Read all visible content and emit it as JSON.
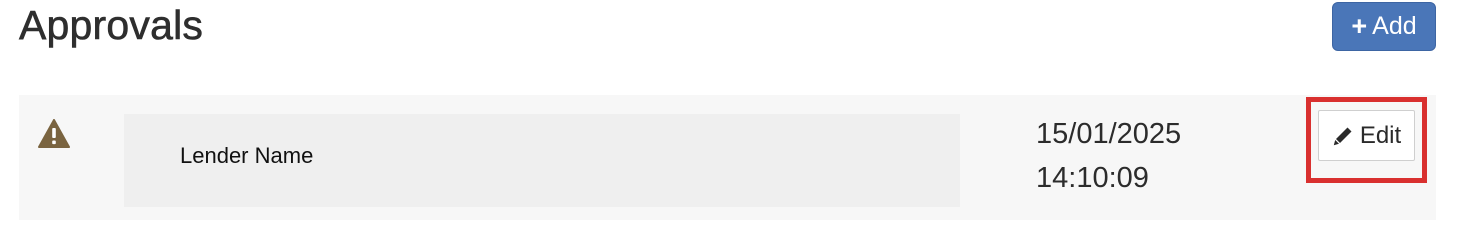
{
  "header": {
    "title": "Approvals",
    "add_label": "Add"
  },
  "approval": {
    "lender_name": "Lender Name",
    "date": "15/01/2025",
    "time": "14:10:09",
    "edit_label": "Edit",
    "status_icon": "warning-icon"
  },
  "colors": {
    "add_button_bg": "#4a76b8",
    "warning_icon": "#7a6440",
    "highlight_border": "#d9302f"
  }
}
